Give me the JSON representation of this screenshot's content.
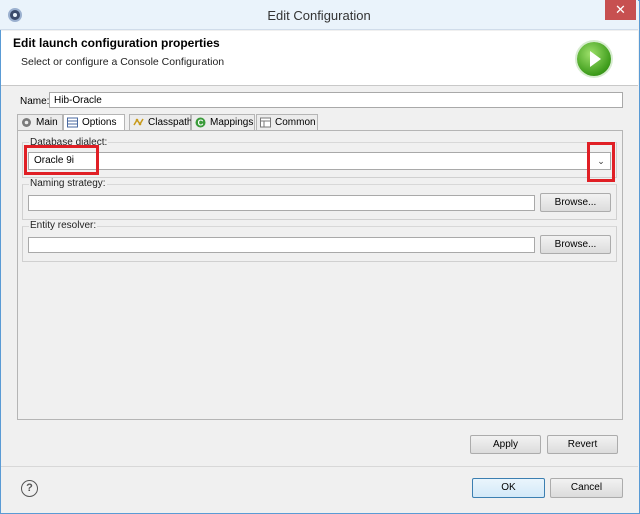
{
  "window": {
    "title": "Edit Configuration",
    "close_label": "✕"
  },
  "header": {
    "title": "Edit launch configuration properties",
    "subtitle": "Select or configure a Console Configuration",
    "run_icon": "run-icon"
  },
  "name": {
    "label": "Name:",
    "value": "Hib-Oracle"
  },
  "tabs": [
    {
      "label": "Main",
      "icon": "main-tab-icon",
      "active": false
    },
    {
      "label": "Options",
      "icon": "options-tab-icon",
      "active": true
    },
    {
      "label": "Classpath",
      "icon": "classpath-tab-icon",
      "active": false
    },
    {
      "label": "Mappings",
      "icon": "mappings-tab-icon",
      "active": false
    },
    {
      "label": "Common",
      "icon": "common-tab-icon",
      "active": false
    }
  ],
  "options": {
    "dialect_label": "Database dialect:",
    "dialect_value": "Oracle 9i",
    "naming_label": "Naming strategy:",
    "naming_value": "",
    "naming_browse": "Browse...",
    "resolver_label": "Entity resolver:",
    "resolver_value": "",
    "resolver_browse": "Browse..."
  },
  "actions": {
    "apply": "Apply",
    "revert": "Revert",
    "ok": "OK",
    "cancel": "Cancel",
    "help": "?"
  },
  "colors": {
    "highlight": "#e01f25",
    "titlebar": "#eaf3fb",
    "close": "#c75050"
  }
}
